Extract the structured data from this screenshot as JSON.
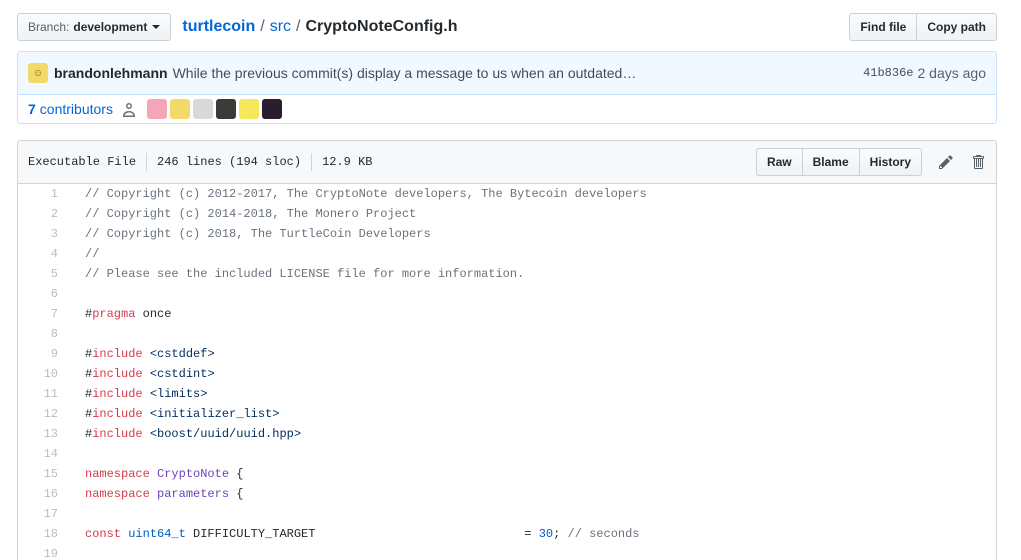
{
  "breadcrumb": {
    "branch_prefix": "Branch:",
    "branch_name": "development",
    "repo": "turtlecoin",
    "sep1": "/",
    "dir": "src",
    "sep2": "/",
    "file": "CryptoNoteConfig.h"
  },
  "top_actions": {
    "find_file": "Find file",
    "copy_path": "Copy path"
  },
  "commit": {
    "author": "brandonlehmann",
    "message": "While the previous commit(s) display a message to us when an outdated…",
    "sha": "41b836e",
    "age": "2 days ago"
  },
  "contributors": {
    "count": "7",
    "label": "contributors",
    "avatar_colors": [
      "#f4a6b8",
      "#f3d86a",
      "#d9d9d9",
      "#3b3a36",
      "#f5e85a",
      "#2a1d2e"
    ]
  },
  "file": {
    "mode": "Executable File",
    "lines": "246 lines (194 sloc)",
    "size": "12.9 KB",
    "raw": "Raw",
    "blame": "Blame",
    "history": "History"
  },
  "code_lines": [
    {
      "n": "1",
      "parts": [
        {
          "c": "c",
          "t": "// Copyright (c) 2012-2017, The CryptoNote developers, The Bytecoin developers"
        }
      ]
    },
    {
      "n": "2",
      "parts": [
        {
          "c": "c",
          "t": "// Copyright (c) 2014-2018, The Monero Project"
        }
      ]
    },
    {
      "n": "3",
      "parts": [
        {
          "c": "c",
          "t": "// Copyright (c) 2018, The TurtleCoin Developers"
        }
      ]
    },
    {
      "n": "4",
      "parts": [
        {
          "c": "c",
          "t": "//"
        }
      ]
    },
    {
      "n": "5",
      "parts": [
        {
          "c": "c",
          "t": "// Please see the included LICENSE file for more information."
        }
      ]
    },
    {
      "n": "6",
      "parts": []
    },
    {
      "n": "7",
      "parts": [
        {
          "c": "",
          "t": "#"
        },
        {
          "c": "k",
          "t": "pragma"
        },
        {
          "c": "",
          "t": " once"
        }
      ]
    },
    {
      "n": "8",
      "parts": []
    },
    {
      "n": "9",
      "parts": [
        {
          "c": "",
          "t": "#"
        },
        {
          "c": "k",
          "t": "include"
        },
        {
          "c": "",
          "t": " "
        },
        {
          "c": "s",
          "t": "<cstddef>"
        }
      ]
    },
    {
      "n": "10",
      "parts": [
        {
          "c": "",
          "t": "#"
        },
        {
          "c": "k",
          "t": "include"
        },
        {
          "c": "",
          "t": " "
        },
        {
          "c": "s",
          "t": "<cstdint>"
        }
      ]
    },
    {
      "n": "11",
      "parts": [
        {
          "c": "",
          "t": "#"
        },
        {
          "c": "k",
          "t": "include"
        },
        {
          "c": "",
          "t": " "
        },
        {
          "c": "s",
          "t": "<limits>"
        }
      ]
    },
    {
      "n": "12",
      "parts": [
        {
          "c": "",
          "t": "#"
        },
        {
          "c": "k",
          "t": "include"
        },
        {
          "c": "",
          "t": " "
        },
        {
          "c": "s",
          "t": "<initializer_list>"
        }
      ]
    },
    {
      "n": "13",
      "parts": [
        {
          "c": "",
          "t": "#"
        },
        {
          "c": "k",
          "t": "include"
        },
        {
          "c": "",
          "t": " "
        },
        {
          "c": "s",
          "t": "<boost/uuid/uuid.hpp>"
        }
      ]
    },
    {
      "n": "14",
      "parts": []
    },
    {
      "n": "15",
      "parts": [
        {
          "c": "k",
          "t": "namespace"
        },
        {
          "c": "",
          "t": " "
        },
        {
          "c": "t",
          "t": "CryptoNote"
        },
        {
          "c": "",
          "t": " {"
        }
      ]
    },
    {
      "n": "16",
      "parts": [
        {
          "c": "k",
          "t": "namespace"
        },
        {
          "c": "",
          "t": " "
        },
        {
          "c": "t",
          "t": "parameters"
        },
        {
          "c": "",
          "t": " {"
        }
      ]
    },
    {
      "n": "17",
      "parts": []
    },
    {
      "n": "18",
      "parts": [
        {
          "c": "k",
          "t": "const"
        },
        {
          "c": "",
          "t": " "
        },
        {
          "c": "n",
          "t": "uint64_t"
        },
        {
          "c": "",
          "t": " DIFFICULTY_TARGET                             = "
        },
        {
          "c": "n",
          "t": "30"
        },
        {
          "c": "",
          "t": "; "
        },
        {
          "c": "c",
          "t": "// seconds"
        }
      ]
    },
    {
      "n": "19",
      "parts": []
    }
  ]
}
